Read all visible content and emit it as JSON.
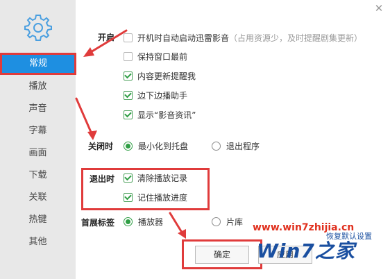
{
  "sidebar": {
    "items": [
      {
        "label": "常规"
      },
      {
        "label": "播放"
      },
      {
        "label": "声音"
      },
      {
        "label": "字幕"
      },
      {
        "label": "画面"
      },
      {
        "label": "下载"
      },
      {
        "label": "关联"
      },
      {
        "label": "热键"
      },
      {
        "label": "其他"
      }
    ]
  },
  "sections": {
    "startup": {
      "label": "开启",
      "options": [
        {
          "text": "开机时自动启动迅雷影音",
          "hint": "（占用资源少，及时提醒剧集更新）",
          "checked": false
        },
        {
          "text": "保持窗口最前",
          "checked": false
        },
        {
          "text": "内容更新提醒我",
          "checked": true
        },
        {
          "text": "边下边播助手",
          "checked": true
        },
        {
          "text": "显示“影音资讯”",
          "checked": true
        }
      ]
    },
    "close": {
      "label": "关闭时",
      "options": [
        {
          "text": "最小化到托盘",
          "selected": true
        },
        {
          "text": "退出程序",
          "selected": false
        }
      ]
    },
    "exit": {
      "label": "退出时",
      "options": [
        {
          "text": "清除播放记录",
          "checked": true
        },
        {
          "text": "记住播放进度",
          "checked": true
        }
      ]
    },
    "home_tab": {
      "label": "首展标签",
      "options": [
        {
          "text": "播放器",
          "selected": true
        },
        {
          "text": "片库",
          "selected": false
        }
      ]
    }
  },
  "buttons": {
    "ok": "确定",
    "apply": "应用",
    "restore_defaults": "恢复默认设置"
  },
  "watermark": {
    "url": "www.win7zhijia.cn",
    "brand": "Win7之家"
  },
  "colors": {
    "active_nav": "#1e8fe1",
    "highlight": "#e03b3b",
    "check": "#2f9e44"
  }
}
